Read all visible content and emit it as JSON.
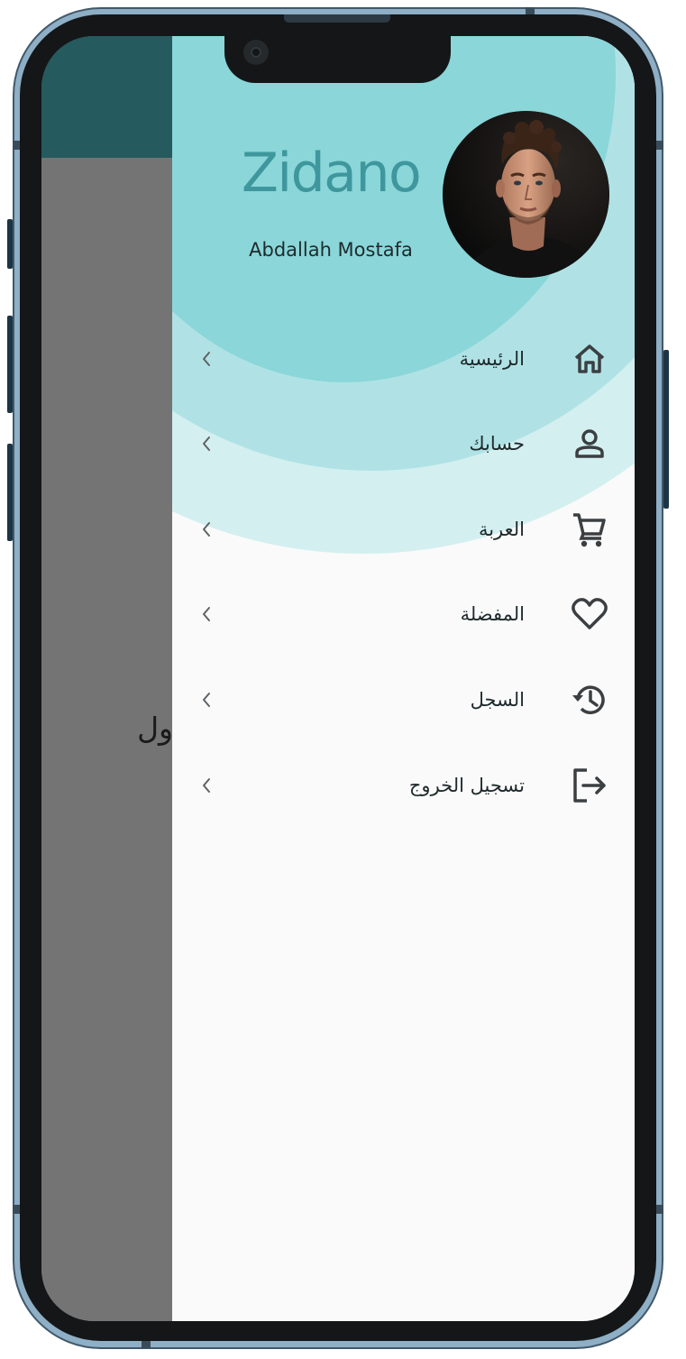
{
  "background_page": {
    "partial_text": "ول"
  },
  "drawer": {
    "app_title": "Zidano",
    "user_name": "Abdallah Mostafa",
    "colors": {
      "accent": "#3e979c",
      "circle_inner": "#8ad6d9",
      "circle_middle": "#b0e2e5",
      "circle_outer": "#d4eff0",
      "icon": "#3b3f42"
    },
    "items": [
      {
        "label": "الرئيسية",
        "icon": "home-icon"
      },
      {
        "label": "حسابك",
        "icon": "person-icon"
      },
      {
        "label": "العربة",
        "icon": "cart-icon"
      },
      {
        "label": "المفضلة",
        "icon": "heart-icon"
      },
      {
        "label": "السجل",
        "icon": "history-icon"
      },
      {
        "label": "تسجيل الخروج",
        "icon": "logout-icon"
      }
    ]
  }
}
